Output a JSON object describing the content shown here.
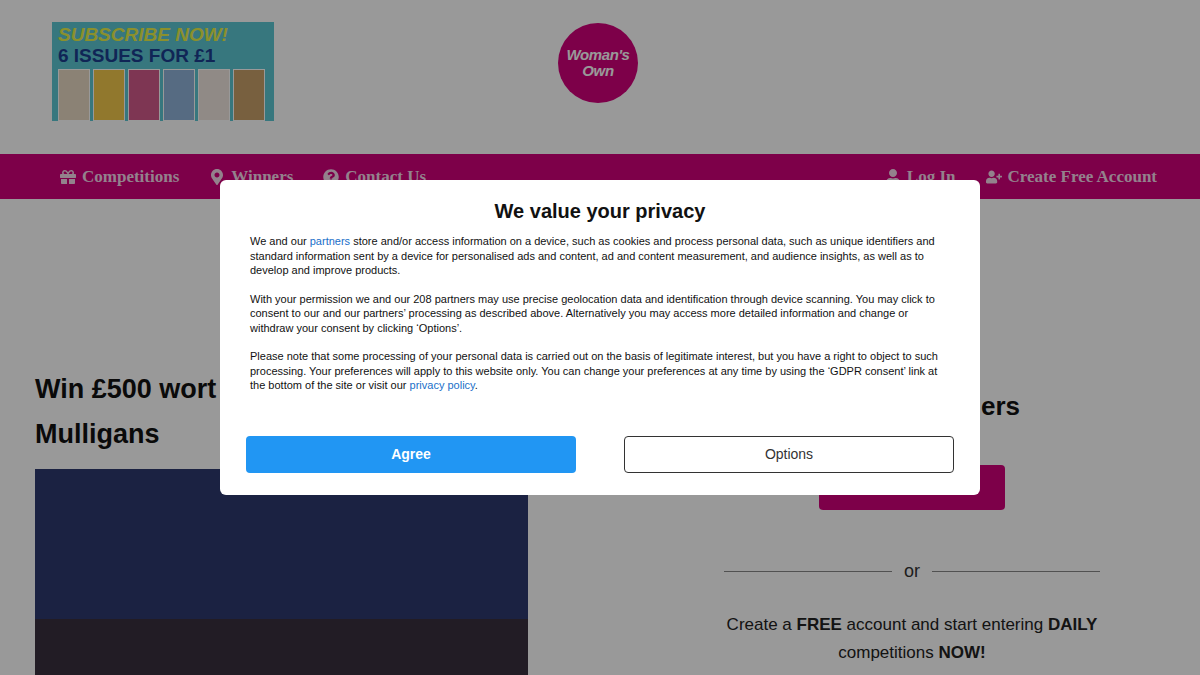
{
  "header": {
    "ad": {
      "lines": [
        "SUBSCRIBE NOW!",
        "6 ISSUES FOR £1"
      ]
    },
    "logo": {
      "lines": [
        "Woman's",
        "Own"
      ]
    }
  },
  "nav": {
    "left": [
      {
        "label": "Competitions"
      },
      {
        "label": "Winners"
      },
      {
        "label": "Contact Us"
      }
    ],
    "right": [
      {
        "label": "Log In"
      },
      {
        "label": "Create Free Account"
      }
    ]
  },
  "competition": {
    "title_lines": [
      "Win £500 wort",
      "Mulligans"
    ]
  },
  "sidebar": {
    "heading": "ers",
    "or": "or",
    "signup_lines": [
      [
        {
          "text": "Create a ",
          "bold": false
        },
        {
          "text": "FREE",
          "bold": true
        },
        {
          "text": " account and start entering ",
          "bold": false
        },
        {
          "text": "DAILY",
          "bold": true
        }
      ],
      [
        {
          "text": "competitions ",
          "bold": false
        },
        {
          "text": "NOW!",
          "bold": true
        }
      ]
    ]
  },
  "dialog": {
    "title": "We value your privacy",
    "paragraphs": [
      [
        {
          "text": "We and our ",
          "link": false
        },
        {
          "text": "partners",
          "link": true
        },
        {
          "text": " store and/or access information on a device, such as cookies and process personal data, such as unique identifiers and standard information sent by a device for personalised ads and content, ad and content measurement, and audience insights, as well as to develop and improve products.",
          "link": false
        }
      ],
      [
        {
          "text": "With your permission we and our 208 partners may use precise geolocation data and identification through device scanning. You may click to consent to our and our partners’ processing as described above. Alternatively you may access more detailed information and change or withdraw your consent by clicking ‘Options’.",
          "link": false
        }
      ],
      [
        {
          "text": "Please note that some processing of your personal data is carried out on the basis of legitimate interest, but you have a right to object to such processing. Your preferences will apply to this website only. You can change your preferences at any time by using the ‘GDPR consent’ link at the bottom of the site or visit our ",
          "link": false
        },
        {
          "text": "privacy policy",
          "link": true
        },
        {
          "text": ".",
          "link": false
        }
      ]
    ],
    "buttons": [
      {
        "label": "Agree",
        "primary": true
      },
      {
        "label": "Options",
        "primary": false
      }
    ]
  }
}
